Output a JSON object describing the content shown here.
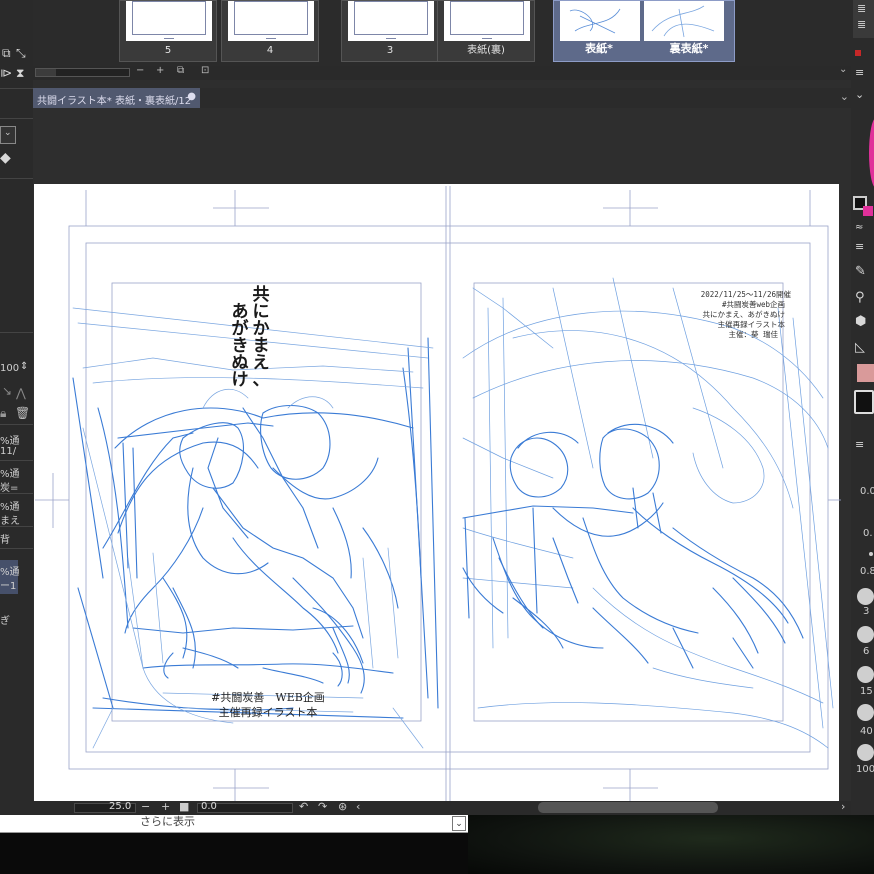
{
  "app": {
    "document_tab": "共闘イラスト本* 表紙・裏表紙/12",
    "document_tab_close": "●"
  },
  "page_strip": {
    "thumbs": [
      {
        "label": "5",
        "selected": false
      },
      {
        "label": "4",
        "selected": false
      },
      {
        "label": "3",
        "selected": false
      },
      {
        "label": "表紙(裏)",
        "selected": false
      },
      {
        "label": "表紙*",
        "selected": true
      },
      {
        "label": "裏表紙*",
        "selected": true
      }
    ],
    "zoom_minus": "−",
    "zoom_plus": "+"
  },
  "canvas": {
    "cover_title": "共にかまえ、あがきぬけ",
    "cover_bottom_line1": "#共闘炭善　WEB企画",
    "cover_bottom_line2": "主催再録イラスト本",
    "back_info": [
      "2022/11/25～11/26開催",
      "#共闘炭善web企画",
      "共にかまえ、あがきぬけ",
      "主催再録イラスト本",
      "主催：葵 瑞佳"
    ],
    "sketch_color": "#3a7bd5"
  },
  "bottom_bar": {
    "zoom_value": "25.0",
    "zoom_minus": "−",
    "zoom_plus": "+",
    "rotation_value": "0.0"
  },
  "left_panel": {
    "opacity_value": "100",
    "layer_labels": [
      "%通",
      "11/",
      "%通",
      "炭=",
      "%通",
      "まえ",
      "背",
      "%通",
      "ー1"
    ],
    "more_label": "ぎ"
  },
  "right_panel": {
    "brush_sizes": [
      "0.0",
      "0.",
      "0.8",
      "3",
      "6",
      "15",
      "40",
      "100"
    ]
  },
  "footer": {
    "select_text": "さらに表示"
  },
  "colors": {
    "ui_bg": "#2e2e2e",
    "selected_thumb": "#5e6a8a",
    "tab_bg": "#51596f",
    "accent_magenta": "#e0309a"
  }
}
